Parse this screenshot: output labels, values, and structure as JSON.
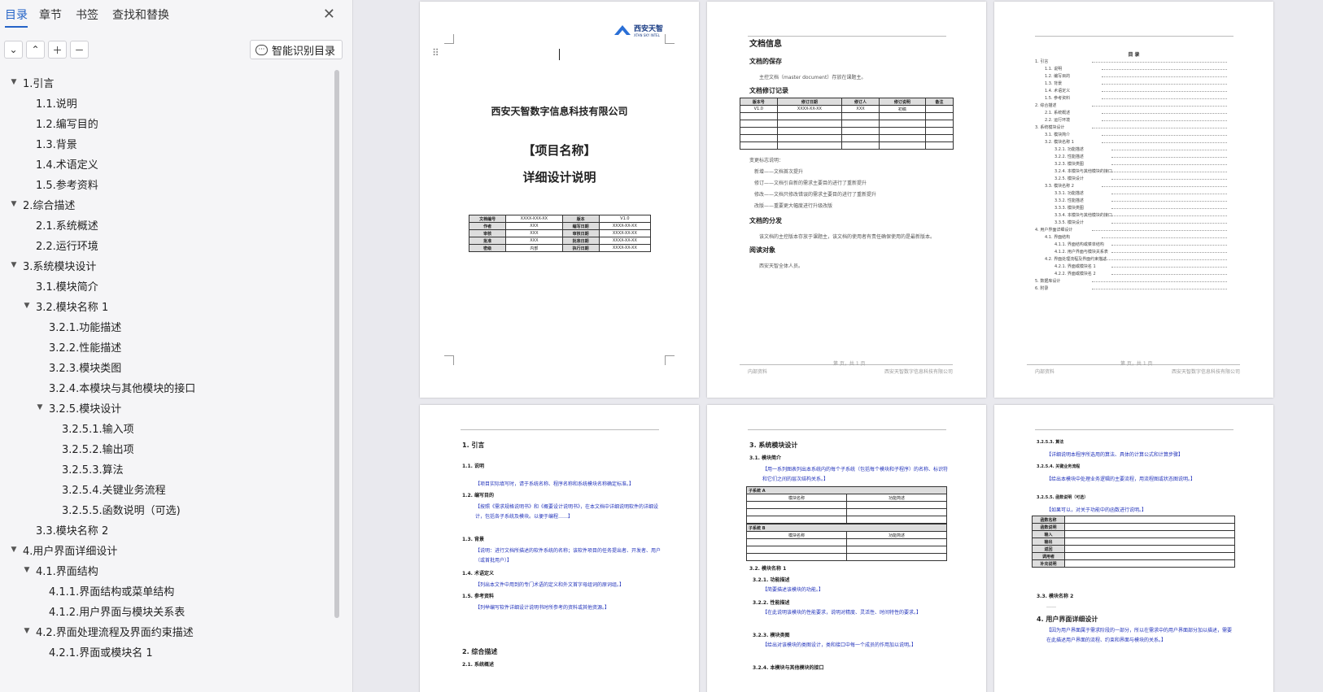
{
  "nav": {
    "tabs": [
      "目录",
      "章节",
      "书签",
      "查找和替换"
    ],
    "active_tab": 0,
    "smart_button": "智能识别目录",
    "toc": [
      {
        "label": "1.引言",
        "level": 0,
        "caret": "▼"
      },
      {
        "label": "1.1.说明",
        "level": 1
      },
      {
        "label": "1.2.编写目的",
        "level": 1
      },
      {
        "label": "1.3.背景",
        "level": 1
      },
      {
        "label": "1.4.术语定义",
        "level": 1
      },
      {
        "label": "1.5.参考资料",
        "level": 1
      },
      {
        "label": "2.综合描述",
        "level": 0,
        "caret": "▼"
      },
      {
        "label": "2.1.系统概述",
        "level": 1
      },
      {
        "label": "2.2.运行环境",
        "level": 1
      },
      {
        "label": "3.系统模块设计",
        "level": 0,
        "caret": "▼"
      },
      {
        "label": "3.1.模块简介",
        "level": 1
      },
      {
        "label": "3.2.模块名称 1",
        "level": 1,
        "caret": "▼"
      },
      {
        "label": "3.2.1.功能描述",
        "level": 2
      },
      {
        "label": "3.2.2.性能描述",
        "level": 2
      },
      {
        "label": "3.2.3.模块类图",
        "level": 2
      },
      {
        "label": "3.2.4.本模块与其他模块的接口",
        "level": 2
      },
      {
        "label": "3.2.5.模块设计",
        "level": 2,
        "caret": "▼"
      },
      {
        "label": "3.2.5.1.输入项",
        "level": 3
      },
      {
        "label": "3.2.5.2.输出项",
        "level": 3
      },
      {
        "label": "3.2.5.3.算法",
        "level": 3
      },
      {
        "label": "3.2.5.4.关键业务流程",
        "level": 3
      },
      {
        "label": "3.2.5.5.函数说明（可选)",
        "level": 3
      },
      {
        "label": "3.3.模块名称 2",
        "level": 1
      },
      {
        "label": "4.用户界面详细设计",
        "level": 0,
        "caret": "▼"
      },
      {
        "label": "4.1.界面结构",
        "level": 1,
        "caret": "▼"
      },
      {
        "label": "4.1.1.界面结构或菜单结构",
        "level": 2
      },
      {
        "label": "4.1.2.用户界面与模块关系表",
        "level": 2
      },
      {
        "label": "4.2.界面处理流程及界面约束描述",
        "level": 1,
        "caret": "▼"
      },
      {
        "label": "4.2.1.界面或模块名 1",
        "level": 2
      }
    ]
  },
  "page1": {
    "logo": "西安天智",
    "logo_sub": "XTAN SKY INTEL",
    "company": "西安天智数字信息科技有限公司",
    "project": "【项目名称】",
    "doc_title": "详细设计说明",
    "table": [
      [
        "文档编号",
        "XXXX-XXX-XX",
        "版本",
        "V1.0"
      ],
      [
        "作者",
        "XXX",
        "编写日期",
        "XXXX-XX-XX"
      ],
      [
        "审核",
        "XXX",
        "审核日期",
        "XXXX-XX-XX"
      ],
      [
        "批准",
        "XXX",
        "批准日期",
        "XXXX-XX-XX"
      ],
      [
        "密级",
        "内部",
        "执行日期",
        "XXXX-XX-XX"
      ]
    ]
  },
  "page2": {
    "title": "文档信息",
    "storage_h": "文档的保存",
    "storage_t": "主控文档（master document）存放在课题主。",
    "revision_h": "文档修订记录",
    "rev_headers": [
      "版本号",
      "修订日期",
      "修订人",
      "修订说明",
      "备注"
    ],
    "rev_row": [
      "V1.0",
      "XXXX-XX-XX",
      "XXX",
      "初稿",
      ""
    ],
    "notes": [
      "变更标志说明：",
      "新增——文档首次提升",
      "修订——文档引自新的需求主要目的进行了重新提升",
      "修改——文档只修改错误的需求主要目的进行了重新提升",
      "改版——重要更大幅度进行升级改版"
    ],
    "dist_h": "文档的分发",
    "dist_t": "该文档的主控版本存放于课题主，该文档的使用者有责任确保使用的是最新版本。",
    "reader_h": "阅读对象",
    "reader_t": "西安天智全体人员。",
    "footer_l": "内部资料",
    "footer_c": "第 页，共 1 页",
    "footer_r": "西安天智数字信息科技有限公司"
  },
  "page3": {
    "title": "目  录",
    "entries": [
      "1. 引言",
      "1.1. 说明",
      "1.2. 编写目的",
      "1.3. 背景",
      "1.4. 术语定义",
      "1.5. 参考资料",
      "2. 综合描述",
      "2.1. 系统概述",
      "2.2. 运行环境",
      "3. 系统模块设计",
      "3.1. 模块简介",
      "3.2. 模块名称 1",
      "3.2.1. 功能描述",
      "3.2.2. 性能描述",
      "3.2.3. 模块类图",
      "3.2.4. 本模块与其他模块的接口",
      "3.2.5. 模块设计",
      "3.3. 模块名称 2",
      "3.3.1. 功能描述",
      "3.3.2. 性能描述",
      "3.3.3. 模块类图",
      "3.3.4. 本模块与其他模块的接口",
      "3.3.5. 模块设计",
      "4. 用户界面详细设计",
      "4.1. 界面结构",
      "4.1.1. 界面结构或菜单结构",
      "4.1.2. 用户界面与模块关系表",
      "4.2. 界面处理流程及界面约束描述",
      "4.2.1. 界面或模块名 1",
      "4.2.2. 界面或模块名 2",
      "5. 数据库设计",
      "6. 附录"
    ],
    "footer_c": "第 页，共 1 页"
  },
  "page4": {
    "h1": "1.  引言",
    "s11": "1.1. 说明",
    "t11": "【项目实际填写时，请于系统名称、程序名称和系统模块名称确定标准。】",
    "s12": "1.2. 编写目的",
    "t12": "【按照《需求规格说明书》和《概要设计说明书》，在本文档中详细说明软件的详细设计，包括各子系统及模块。以便于编程……】",
    "s13": "1.3. 背景",
    "t13": "【说明：进行文档所描述的软件系统的名称；该软件项目的任务提出者、开发者、用户（或首批用户）】",
    "s14": "1.4. 术语定义",
    "t14": "【列出本文件中用到的专门术语的定义和外文首字母组词的原词组。】",
    "s15": "1.5. 参考资料",
    "t15": "【列举编写软件详细设计说明书时所参考的资料或其他资源。】",
    "h2": "2.  综合描述",
    "s21": "2.1. 系统概述"
  },
  "page5": {
    "h3": "3.  系统模块设计",
    "s31": "3.1. 模块简介",
    "t31": "【用一系列图表列出本系统内的每个子系统（包括每个模块和子程序）的名称、标识符和它们之间的层次结构关系。】",
    "tbl1_h": "子系统 A",
    "col1": "模块名称",
    "col2": "功能简述",
    "tbl2_h": "子系统 B",
    "s32": "3.2. 模块名称 1",
    "s321": "3.2.1. 功能描述",
    "t321": "【简要描述该模块的功能。】",
    "s322": "3.2.2. 性能描述",
    "t322": "【在此说明该模块的性能要求，说明对精度、灵活性、时间特性的要求。】",
    "s323": "3.2.3. 模块类图",
    "t323": "【给出对该模块的类图设计，类和接口中每一个成员的作用加以说明。】",
    "s324": "3.2.4. 本模块与其他模块的接口"
  },
  "page6": {
    "s3253": "3.2.5.3. 算法",
    "t3253": "【详细说明本程序所选用的算法、具体的计算公式和计算步骤】",
    "s3254": "3.2.5.4. 关键业务流程",
    "t3254": "【给出本模块中处理业务逻辑的主要流程，用流程图或状态图说明。】",
    "s3255": "3.2.5.5. 函数说明（可选）",
    "t3255": "【如果可以，对关于功能中的函数进行说明。】",
    "fn_rows": [
      "函数名称",
      "函数说明",
      "输入",
      "输出",
      "返回",
      "调用者",
      "补充说明"
    ],
    "s33": "3.3. 模块名称 2",
    "t33": "……",
    "h4": "4.  用户界面详细设计",
    "t4": "【因为用户界面属于需求阶段的一部分，所以在需求中的用户界面部分加以描述，需要在此描述用户界面的流程、约束和界面与模块的关系。】"
  }
}
